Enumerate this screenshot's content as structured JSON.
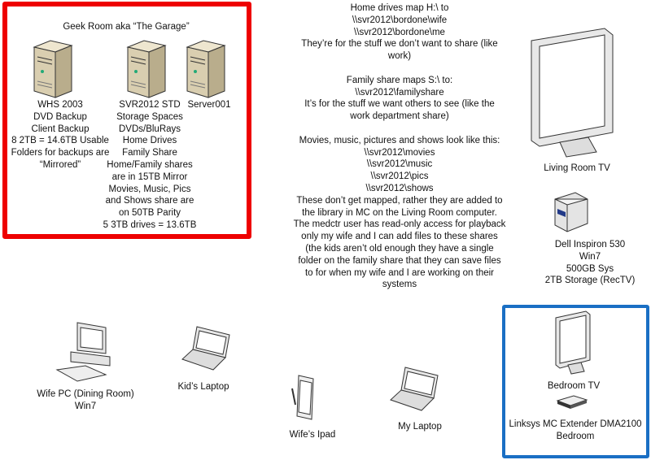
{
  "colors": {
    "geek_room_border": "#ee0000",
    "bedroom_border": "#1a6fc4",
    "server_tan": "#d9ceb0"
  },
  "geek_room": {
    "title": "Geek Room aka “The Garage”",
    "servers": [
      {
        "icon": "server-tower-icon",
        "lines": [
          "WHS 2003",
          "DVD Backup",
          "Client Backup",
          "8 2TB = 14.6TB Usable",
          "Folders for backups are",
          "“Mirrored”"
        ]
      },
      {
        "icon": "server-tower-icon",
        "lines": [
          "SVR2012 STD",
          "Storage Spaces",
          "DVDs/BluRays",
          "Home Drives",
          "Family Share",
          "Home/Family shares",
          "are in 15TB Mirror",
          "Movies, Music, Pics",
          "and Shows share are",
          "on 50TB Parity",
          "5 3TB drives = 13.6TB"
        ]
      },
      {
        "icon": "server-tower-icon",
        "lines": [
          "Server001"
        ]
      }
    ]
  },
  "notes": [
    "Home drives map H:\\ to",
    "\\\\svr2012\\bordone\\wife",
    "\\\\svr2012\\bordone\\me",
    "They’re for the stuff we don’t want to share (like",
    "work)",
    "",
    "Family share maps S:\\ to:",
    "\\\\svr2012\\familyshare",
    "It’s for the stuff we want others to see (like the",
    "work department share)",
    "",
    "Movies, music, pictures and shows look like this:",
    "\\\\svr2012\\movies",
    "\\\\svr2012\\music",
    "\\\\svr2012\\pics",
    "\\\\svr2012\\shows",
    "These don’t get mapped, rather they are added to",
    "the library in MC on the Living Room computer.",
    "The medctr user has read-only access for playback",
    "only my wife and I can add files to these shares",
    "(the kids aren’t old enough they have a single",
    "folder on the family share that they can save files",
    "to for when my wife and I are working on their",
    "systems"
  ],
  "devices": {
    "living_room_tv": {
      "icon": "monitor-icon",
      "lines": [
        "Living Room TV"
      ]
    },
    "dell": {
      "icon": "desktop-box-icon",
      "lines": [
        "Dell Inspiron 530",
        "Win7",
        "500GB Sys",
        "2TB Storage (RecTV)"
      ]
    },
    "wife_pc": {
      "icon": "desktop-pc-icon",
      "lines": [
        "Wife PC (Dining Room)",
        "Win7"
      ]
    },
    "kids_laptop": {
      "icon": "laptop-icon",
      "lines": [
        "Kid’s Laptop"
      ]
    },
    "wifes_ipad": {
      "icon": "tablet-icon",
      "lines": [
        "Wife’s Ipad"
      ]
    },
    "my_laptop": {
      "icon": "laptop-icon",
      "lines": [
        "My Laptop"
      ]
    },
    "bedroom_tv": {
      "icon": "monitor-icon",
      "lines": [
        "Bedroom TV"
      ]
    },
    "linksys": {
      "icon": "media-extender-icon",
      "lines": [
        "Linksys MC Extender DMA2100",
        "Bedroom"
      ]
    }
  }
}
